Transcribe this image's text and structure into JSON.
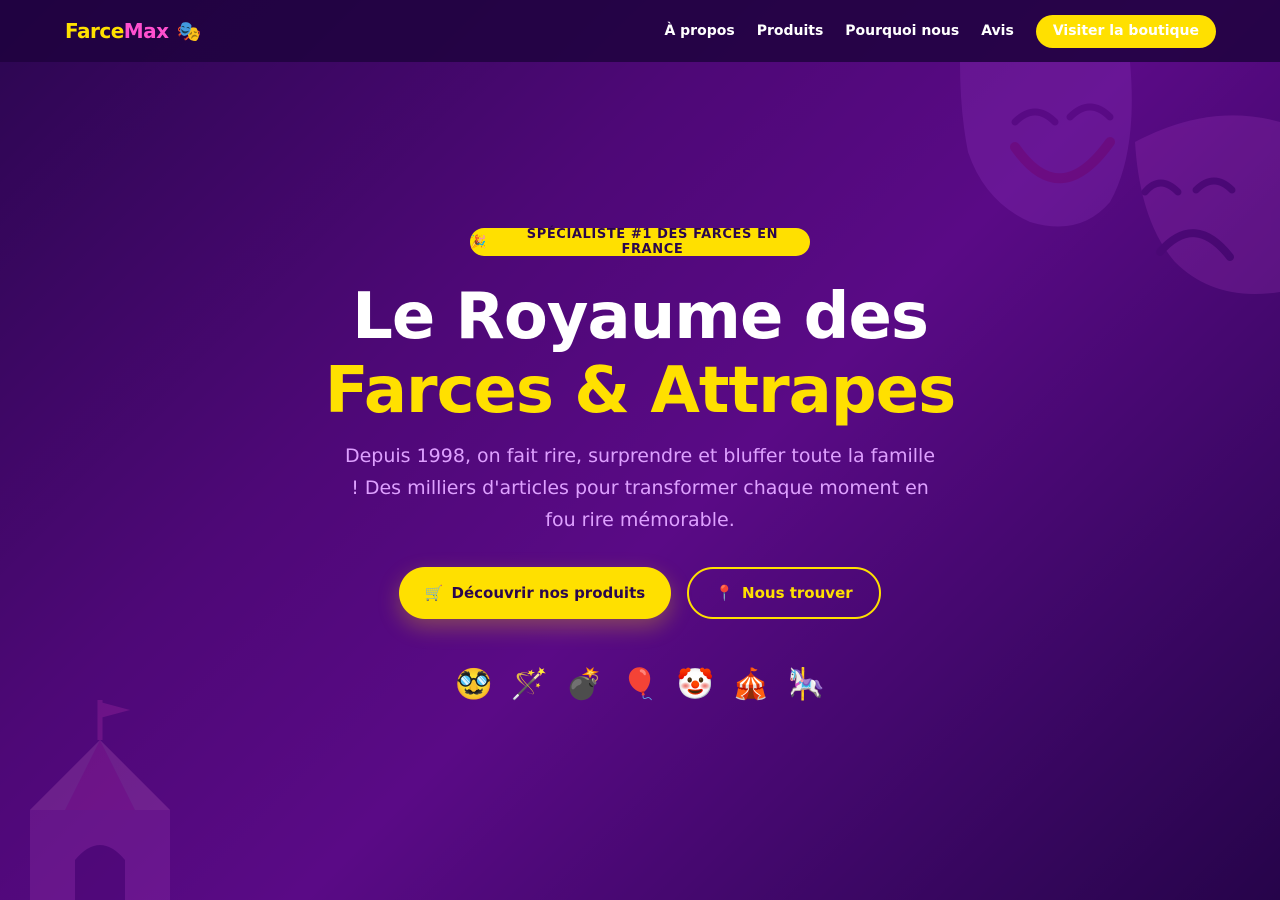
{
  "nav": {
    "logo_part1": "Farce",
    "logo_part2": "Max",
    "logo_emoji": "🎭",
    "links": [
      "À propos",
      "Produits",
      "Pourquoi nous",
      "Avis"
    ],
    "cta_label": "Visiter la boutique"
  },
  "hero": {
    "badge_emoji": "🎉",
    "badge_text": "SPÉCIALISTE #1 DES FARCES EN FRANCE",
    "title_line1": "Le Royaume des",
    "title_line2": "Farces & Attrapes",
    "subtitle": "Depuis 1998, on fait rire, surprendre et bluffer toute la famille ! Des milliers d'articles pour transformer chaque moment en fou rire mémorable.",
    "primary_button_emoji": "🛒",
    "primary_button_label": "Découvrir nos produits",
    "secondary_button_emoji": "📍",
    "secondary_button_label": "Nous trouver",
    "emojis": [
      "🥸",
      "🪄",
      "💣",
      "🎈",
      "🤡",
      "🎪",
      "🎠"
    ]
  },
  "colors": {
    "accent": "#ffe000",
    "logo_pink": "#ff4fcf",
    "subtitle": "#dea0ff",
    "background": "#4e0877"
  },
  "decorations": {
    "top_right": "theater-masks-icon",
    "bottom_left": "circus-tent-icon"
  }
}
